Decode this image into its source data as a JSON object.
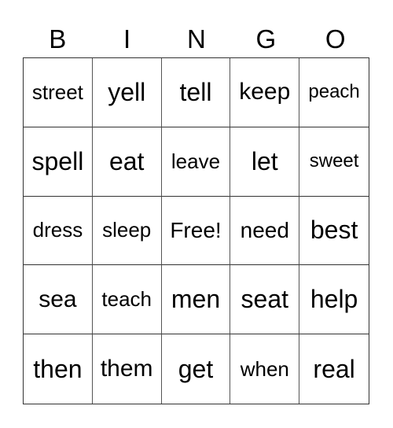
{
  "header": [
    "B",
    "I",
    "N",
    "G",
    "O"
  ],
  "rows": [
    [
      "street",
      "yell",
      "tell",
      "keep",
      "peach"
    ],
    [
      "spell",
      "eat",
      "leave",
      "let",
      "sweet"
    ],
    [
      "dress",
      "sleep",
      "Free!",
      "need",
      "best"
    ],
    [
      "sea",
      "teach",
      "men",
      "seat",
      "help"
    ],
    [
      "then",
      "them",
      "get",
      "when",
      "real"
    ]
  ]
}
